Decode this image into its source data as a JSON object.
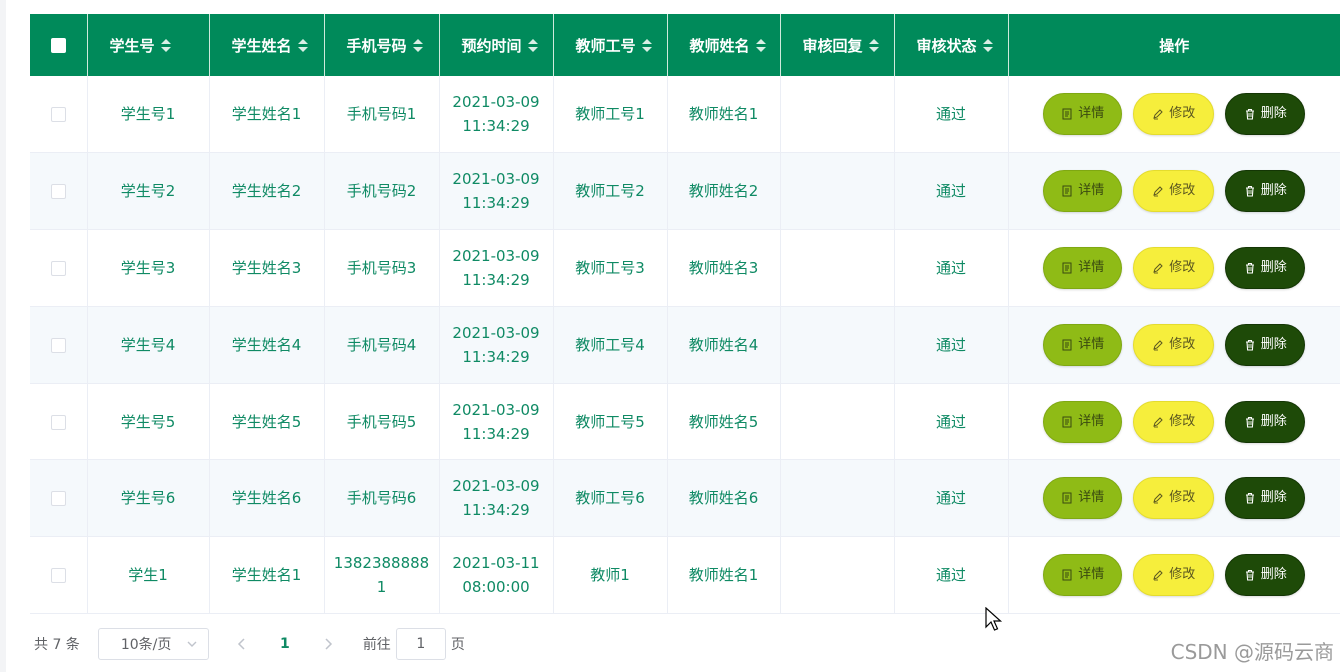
{
  "table": {
    "columns": [
      "学生号",
      "学生姓名",
      "手机号码",
      "预约时间",
      "教师工号",
      "教师姓名",
      "审核回复",
      "审核状态"
    ],
    "actions_header": "操作",
    "rows": [
      {
        "student_no": "学生号1",
        "student_name": "学生姓名1",
        "phone": "手机号码1",
        "date": "2021-03-09",
        "time": "11:34:29",
        "teacher_no": "教师工号1",
        "teacher_name": "教师姓名1",
        "reply": "",
        "status": "通过"
      },
      {
        "student_no": "学生号2",
        "student_name": "学生姓名2",
        "phone": "手机号码2",
        "date": "2021-03-09",
        "time": "11:34:29",
        "teacher_no": "教师工号2",
        "teacher_name": "教师姓名2",
        "reply": "",
        "status": "通过"
      },
      {
        "student_no": "学生号3",
        "student_name": "学生姓名3",
        "phone": "手机号码3",
        "date": "2021-03-09",
        "time": "11:34:29",
        "teacher_no": "教师工号3",
        "teacher_name": "教师姓名3",
        "reply": "",
        "status": "通过"
      },
      {
        "student_no": "学生号4",
        "student_name": "学生姓名4",
        "phone": "手机号码4",
        "date": "2021-03-09",
        "time": "11:34:29",
        "teacher_no": "教师工号4",
        "teacher_name": "教师姓名4",
        "reply": "",
        "status": "通过"
      },
      {
        "student_no": "学生号5",
        "student_name": "学生姓名5",
        "phone": "手机号码5",
        "date": "2021-03-09",
        "time": "11:34:29",
        "teacher_no": "教师工号5",
        "teacher_name": "教师姓名5",
        "reply": "",
        "status": "通过"
      },
      {
        "student_no": "学生号6",
        "student_name": "学生姓名6",
        "phone": "手机号码6",
        "date": "2021-03-09",
        "time": "11:34:29",
        "teacher_no": "教师工号6",
        "teacher_name": "教师姓名6",
        "reply": "",
        "status": "通过"
      },
      {
        "student_no": "学生1",
        "student_name": "学生姓名1",
        "phone": "13823888881",
        "date": "2021-03-11",
        "time": "08:00:00",
        "teacher_no": "教师1",
        "teacher_name": "教师姓名1",
        "reply": "",
        "status": "通过"
      }
    ]
  },
  "buttons": {
    "detail": "详情",
    "edit": "修改",
    "delete": "删除"
  },
  "colors": {
    "header_bg": "#008a5a",
    "text_green": "#0f8a64",
    "detail_bg": "#8fbb16",
    "edit_bg": "#f6ee3c",
    "delete_bg": "#1e4a08"
  },
  "pagination": {
    "total": "共 7 条",
    "page_size": "10条/页",
    "current_page": "1",
    "goto_label": "前往",
    "goto_value": "1",
    "page_suffix": "页"
  },
  "watermark": "CSDN @源码云商"
}
